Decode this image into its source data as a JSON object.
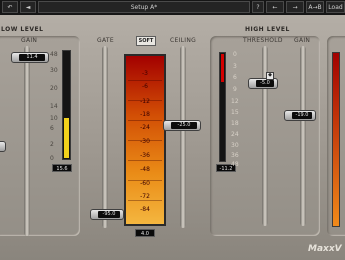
{
  "toolbar": {
    "undo": "↶",
    "left_arrow_1": "◄",
    "setup_label": "Setup A*",
    "question": "?",
    "left_arrow_2": "←",
    "right_arrow": "→",
    "ab_label": "A→B",
    "load_label": "Load"
  },
  "low_level": {
    "title": "LOW LEVEL",
    "gain_label": "GAIN",
    "gain_value": "11.4",
    "scale": [
      "48",
      "30",
      "20",
      "14",
      "10",
      "6",
      "2",
      "0"
    ],
    "meter_readout": "15.6"
  },
  "center": {
    "gate_label": "GATE",
    "soft_label": "SOFT",
    "ceiling_label": "CEILING",
    "gate_value": "-95.0",
    "ceiling_value": "-25.0",
    "gr_scale": [
      "-3",
      "-6",
      "-12",
      "-18",
      "-24",
      "-30",
      "-36",
      "-48",
      "-60",
      "-72",
      "-84"
    ],
    "gr_readout": "4.0"
  },
  "high_level": {
    "title": "HIGH LEVEL",
    "threshold_label": "THRESHOLD",
    "gain_label": "GAIN",
    "threshold_value": "-5.0",
    "gain_value": "-19.0",
    "scale": [
      "0",
      "3",
      "6",
      "9",
      "12",
      "15",
      "18",
      "24",
      "30",
      "36",
      "48"
    ],
    "meter_readout": "-11.2"
  },
  "brand": "MaxxV",
  "colors": {
    "meter_yellow": "#f3d21c",
    "meter_red": "#d40000",
    "gr_top": "#a30000",
    "gr_bottom": "#f4b63f"
  }
}
